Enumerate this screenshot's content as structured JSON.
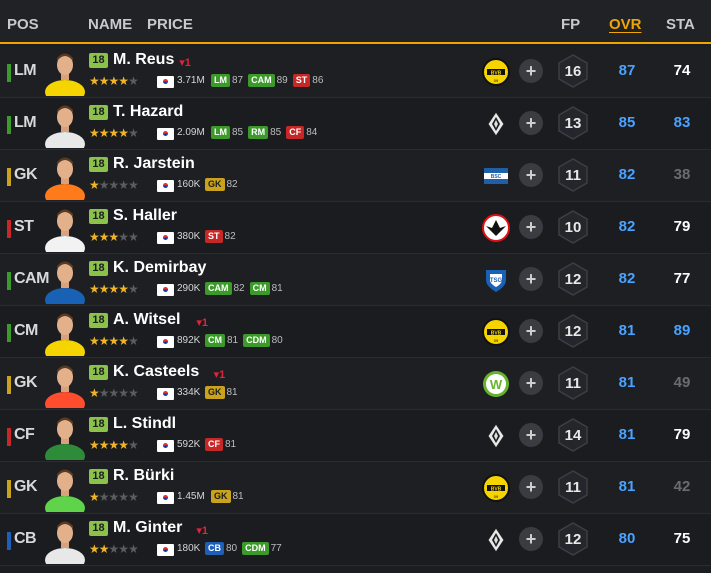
{
  "header": {
    "pos": "POS",
    "name": "NAME",
    "price": "PRICE",
    "fp": "FP",
    "ovr": "OVR",
    "sta": "STA"
  },
  "colors": {
    "accent": "#f0a500",
    "ovr": "#4aa3ff",
    "att": "#c62828",
    "mid": "#3c9a2a",
    "gk": "#caa21c",
    "def": "#1e5fb8"
  },
  "players": [
    {
      "pos": "LM",
      "pos_color": "#3c9a2a",
      "season": "18",
      "name": "M. Reus",
      "trend": "▾1",
      "stars_on": 4,
      "price": "3.71M",
      "chips": [
        {
          "label": "LM",
          "val": "87",
          "c": "green"
        },
        {
          "label": "CAM",
          "val": "89",
          "c": "green"
        },
        {
          "label": "ST",
          "val": "86",
          "c": "red"
        }
      ],
      "club_icon": "dortmund-crest-icon",
      "fp": "16",
      "ovr": "87",
      "sta": "74",
      "sta_style": "hi"
    },
    {
      "pos": "LM",
      "pos_color": "#3c9a2a",
      "season": "18",
      "name": "T. Hazard",
      "trend": "",
      "stars_on": 4,
      "price": "2.09M",
      "chips": [
        {
          "label": "LM",
          "val": "85",
          "c": "green"
        },
        {
          "label": "RM",
          "val": "85",
          "c": "green"
        },
        {
          "label": "CF",
          "val": "84",
          "c": "red"
        }
      ],
      "club_icon": "gladbach-crest-icon",
      "fp": "13",
      "ovr": "85",
      "sta": "83",
      "sta_style": "blue"
    },
    {
      "pos": "GK",
      "pos_color": "#caa21c",
      "season": "18",
      "name": "R. Jarstein",
      "trend": "",
      "stars_on": 1,
      "price": "160K",
      "chips": [
        {
          "label": "GK",
          "val": "82",
          "c": "yellow"
        }
      ],
      "club_icon": "hertha-crest-icon",
      "fp": "11",
      "ovr": "82",
      "sta": "38",
      "sta_style": "lo"
    },
    {
      "pos": "ST",
      "pos_color": "#c62828",
      "season": "18",
      "name": "S. Haller",
      "trend": "",
      "stars_on": 3,
      "price": "380K",
      "chips": [
        {
          "label": "ST",
          "val": "82",
          "c": "red"
        }
      ],
      "club_icon": "frankfurt-crest-icon",
      "fp": "10",
      "ovr": "82",
      "sta": "79",
      "sta_style": "hi"
    },
    {
      "pos": "CAM",
      "pos_color": "#3c9a2a",
      "season": "18",
      "name": "K. Demirbay",
      "trend": "",
      "stars_on": 4,
      "price": "290K",
      "chips": [
        {
          "label": "CAM",
          "val": "82",
          "c": "green"
        },
        {
          "label": "CM",
          "val": "81",
          "c": "green"
        }
      ],
      "club_icon": "hoffenheim-crest-icon",
      "fp": "12",
      "ovr": "82",
      "sta": "77",
      "sta_style": "hi"
    },
    {
      "pos": "CM",
      "pos_color": "#3c9a2a",
      "season": "18",
      "name": "A. Witsel",
      "trend": "▾1",
      "stars_on": 4,
      "price": "892K",
      "chips": [
        {
          "label": "CM",
          "val": "81",
          "c": "green"
        },
        {
          "label": "CDM",
          "val": "80",
          "c": "green"
        }
      ],
      "club_icon": "dortmund-crest-icon",
      "fp": "12",
      "ovr": "81",
      "sta": "89",
      "sta_style": "blue"
    },
    {
      "pos": "GK",
      "pos_color": "#caa21c",
      "season": "18",
      "name": "K. Casteels",
      "trend": "▾1",
      "stars_on": 1,
      "price": "334K",
      "chips": [
        {
          "label": "GK",
          "val": "81",
          "c": "yellow"
        }
      ],
      "club_icon": "wolfsburg-crest-icon",
      "fp": "11",
      "ovr": "81",
      "sta": "49",
      "sta_style": "lo"
    },
    {
      "pos": "CF",
      "pos_color": "#c62828",
      "season": "18",
      "name": "L. Stindl",
      "trend": "",
      "stars_on": 4,
      "price": "592K",
      "chips": [
        {
          "label": "CF",
          "val": "81",
          "c": "red"
        }
      ],
      "club_icon": "gladbach-crest-icon",
      "fp": "14",
      "ovr": "81",
      "sta": "79",
      "sta_style": "hi"
    },
    {
      "pos": "GK",
      "pos_color": "#caa21c",
      "season": "18",
      "name": "R. Bürki",
      "trend": "",
      "stars_on": 1,
      "price": "1.45M",
      "chips": [
        {
          "label": "GK",
          "val": "81",
          "c": "yellow"
        }
      ],
      "club_icon": "dortmund-crest-icon",
      "fp": "11",
      "ovr": "81",
      "sta": "42",
      "sta_style": "lo"
    },
    {
      "pos": "CB",
      "pos_color": "#1e5fb8",
      "season": "18",
      "name": "M. Ginter",
      "trend": "▾1",
      "stars_on": 2,
      "price": "180K",
      "chips": [
        {
          "label": "CB",
          "val": "80",
          "c": "blue"
        },
        {
          "label": "CDM",
          "val": "77",
          "c": "green"
        }
      ],
      "club_icon": "gladbach-crest-icon",
      "fp": "12",
      "ovr": "80",
      "sta": "75",
      "sta_style": "hi"
    }
  ]
}
